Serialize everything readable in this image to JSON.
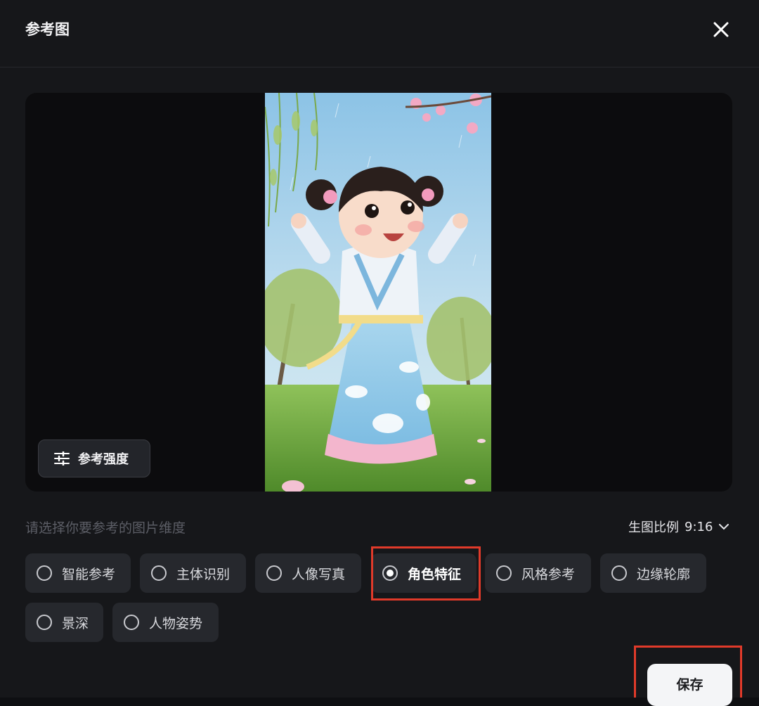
{
  "dialog": {
    "title": "参考图"
  },
  "preview": {
    "strength_label": "参考强度"
  },
  "selector": {
    "hint": "请选择你要参考的图片维度",
    "ratio_label": "生图比例",
    "ratio_value": "9:16",
    "options": [
      {
        "label": "智能参考",
        "selected": false
      },
      {
        "label": "主体识别",
        "selected": false
      },
      {
        "label": "人像写真",
        "selected": false
      },
      {
        "label": "角色特征",
        "selected": true
      },
      {
        "label": "风格参考",
        "selected": false
      },
      {
        "label": "边缘轮廓",
        "selected": false
      },
      {
        "label": "景深",
        "selected": false
      },
      {
        "label": "人物姿势",
        "selected": false
      }
    ]
  },
  "footer": {
    "save_label": "保存"
  },
  "colors": {
    "background": "#16171a",
    "option_bg": "#26282d",
    "highlight_box": "#e03a2a",
    "save_bg": "#f4f5f7"
  }
}
